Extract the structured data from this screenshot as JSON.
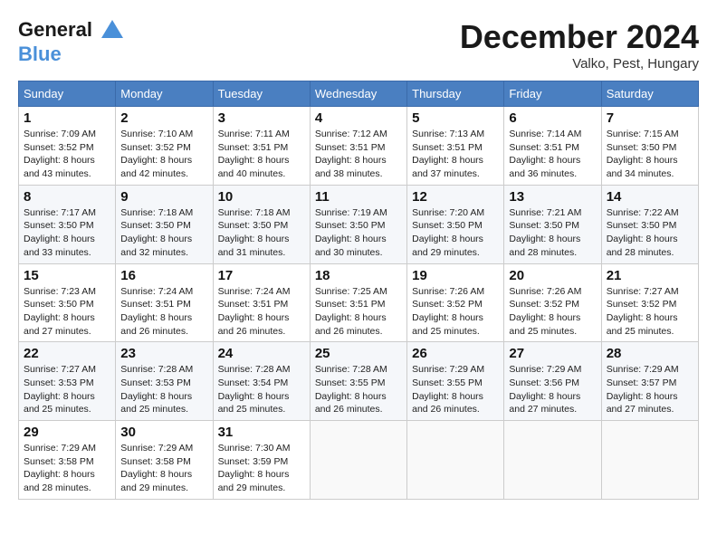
{
  "header": {
    "logo_line1": "General",
    "logo_line2": "Blue",
    "month": "December 2024",
    "location": "Valko, Pest, Hungary"
  },
  "weekdays": [
    "Sunday",
    "Monday",
    "Tuesday",
    "Wednesday",
    "Thursday",
    "Friday",
    "Saturday"
  ],
  "weeks": [
    [
      {
        "day": 1,
        "sunrise": "7:09 AM",
        "sunset": "3:52 PM",
        "daylight": "8 hours and 43 minutes."
      },
      {
        "day": 2,
        "sunrise": "7:10 AM",
        "sunset": "3:52 PM",
        "daylight": "8 hours and 42 minutes."
      },
      {
        "day": 3,
        "sunrise": "7:11 AM",
        "sunset": "3:51 PM",
        "daylight": "8 hours and 40 minutes."
      },
      {
        "day": 4,
        "sunrise": "7:12 AM",
        "sunset": "3:51 PM",
        "daylight": "8 hours and 38 minutes."
      },
      {
        "day": 5,
        "sunrise": "7:13 AM",
        "sunset": "3:51 PM",
        "daylight": "8 hours and 37 minutes."
      },
      {
        "day": 6,
        "sunrise": "7:14 AM",
        "sunset": "3:51 PM",
        "daylight": "8 hours and 36 minutes."
      },
      {
        "day": 7,
        "sunrise": "7:15 AM",
        "sunset": "3:50 PM",
        "daylight": "8 hours and 34 minutes."
      }
    ],
    [
      {
        "day": 8,
        "sunrise": "7:17 AM",
        "sunset": "3:50 PM",
        "daylight": "8 hours and 33 minutes."
      },
      {
        "day": 9,
        "sunrise": "7:18 AM",
        "sunset": "3:50 PM",
        "daylight": "8 hours and 32 minutes."
      },
      {
        "day": 10,
        "sunrise": "7:18 AM",
        "sunset": "3:50 PM",
        "daylight": "8 hours and 31 minutes."
      },
      {
        "day": 11,
        "sunrise": "7:19 AM",
        "sunset": "3:50 PM",
        "daylight": "8 hours and 30 minutes."
      },
      {
        "day": 12,
        "sunrise": "7:20 AM",
        "sunset": "3:50 PM",
        "daylight": "8 hours and 29 minutes."
      },
      {
        "day": 13,
        "sunrise": "7:21 AM",
        "sunset": "3:50 PM",
        "daylight": "8 hours and 28 minutes."
      },
      {
        "day": 14,
        "sunrise": "7:22 AM",
        "sunset": "3:50 PM",
        "daylight": "8 hours and 28 minutes."
      }
    ],
    [
      {
        "day": 15,
        "sunrise": "7:23 AM",
        "sunset": "3:50 PM",
        "daylight": "8 hours and 27 minutes."
      },
      {
        "day": 16,
        "sunrise": "7:24 AM",
        "sunset": "3:51 PM",
        "daylight": "8 hours and 26 minutes."
      },
      {
        "day": 17,
        "sunrise": "7:24 AM",
        "sunset": "3:51 PM",
        "daylight": "8 hours and 26 minutes."
      },
      {
        "day": 18,
        "sunrise": "7:25 AM",
        "sunset": "3:51 PM",
        "daylight": "8 hours and 26 minutes."
      },
      {
        "day": 19,
        "sunrise": "7:26 AM",
        "sunset": "3:52 PM",
        "daylight": "8 hours and 25 minutes."
      },
      {
        "day": 20,
        "sunrise": "7:26 AM",
        "sunset": "3:52 PM",
        "daylight": "8 hours and 25 minutes."
      },
      {
        "day": 21,
        "sunrise": "7:27 AM",
        "sunset": "3:52 PM",
        "daylight": "8 hours and 25 minutes."
      }
    ],
    [
      {
        "day": 22,
        "sunrise": "7:27 AM",
        "sunset": "3:53 PM",
        "daylight": "8 hours and 25 minutes."
      },
      {
        "day": 23,
        "sunrise": "7:28 AM",
        "sunset": "3:53 PM",
        "daylight": "8 hours and 25 minutes."
      },
      {
        "day": 24,
        "sunrise": "7:28 AM",
        "sunset": "3:54 PM",
        "daylight": "8 hours and 25 minutes."
      },
      {
        "day": 25,
        "sunrise": "7:28 AM",
        "sunset": "3:55 PM",
        "daylight": "8 hours and 26 minutes."
      },
      {
        "day": 26,
        "sunrise": "7:29 AM",
        "sunset": "3:55 PM",
        "daylight": "8 hours and 26 minutes."
      },
      {
        "day": 27,
        "sunrise": "7:29 AM",
        "sunset": "3:56 PM",
        "daylight": "8 hours and 27 minutes."
      },
      {
        "day": 28,
        "sunrise": "7:29 AM",
        "sunset": "3:57 PM",
        "daylight": "8 hours and 27 minutes."
      }
    ],
    [
      {
        "day": 29,
        "sunrise": "7:29 AM",
        "sunset": "3:58 PM",
        "daylight": "8 hours and 28 minutes."
      },
      {
        "day": 30,
        "sunrise": "7:29 AM",
        "sunset": "3:58 PM",
        "daylight": "8 hours and 29 minutes."
      },
      {
        "day": 31,
        "sunrise": "7:30 AM",
        "sunset": "3:59 PM",
        "daylight": "8 hours and 29 minutes."
      },
      null,
      null,
      null,
      null
    ]
  ]
}
